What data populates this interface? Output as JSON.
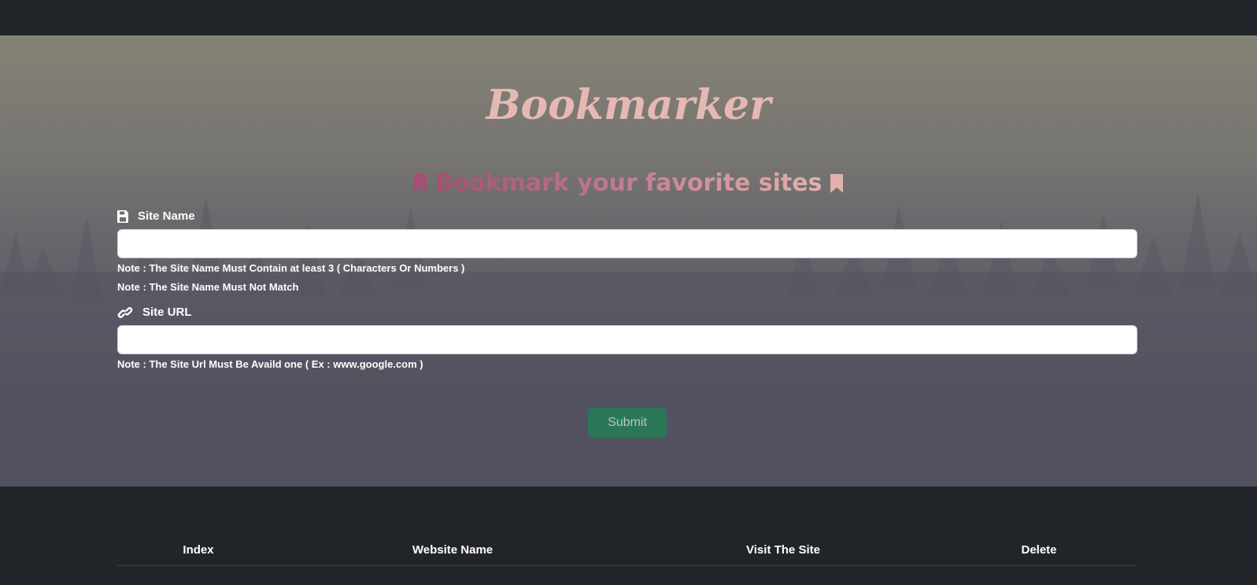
{
  "header": {
    "title": "Bookmarker",
    "subtitle": "Bookmark your favorite sites"
  },
  "form": {
    "site_name": {
      "label": "Site Name",
      "icon": "floppy-disk-icon",
      "value": "",
      "placeholder": "",
      "notes": [
        "Note : The Site Name Must Contain at least 3 ( Characters Or Numbers )",
        "Note : The Site Name Must Not Match"
      ]
    },
    "site_url": {
      "label": "Site URL",
      "icon": "link-icon",
      "value": "",
      "placeholder": "",
      "note": "Note : The Site Url Must Be Availd one ( Ex : www.google.com )"
    },
    "submit_label": "Submit"
  },
  "table": {
    "columns": [
      "Index",
      "Website Name",
      "Visit The Site",
      "Delete"
    ],
    "rows": []
  },
  "colors": {
    "title": "#e6b8b4",
    "subtitle_start": "#a54f72",
    "subtitle_end": "#e3b1ad",
    "submit_bg": "#2a7757",
    "dark_bg": "#212529"
  }
}
